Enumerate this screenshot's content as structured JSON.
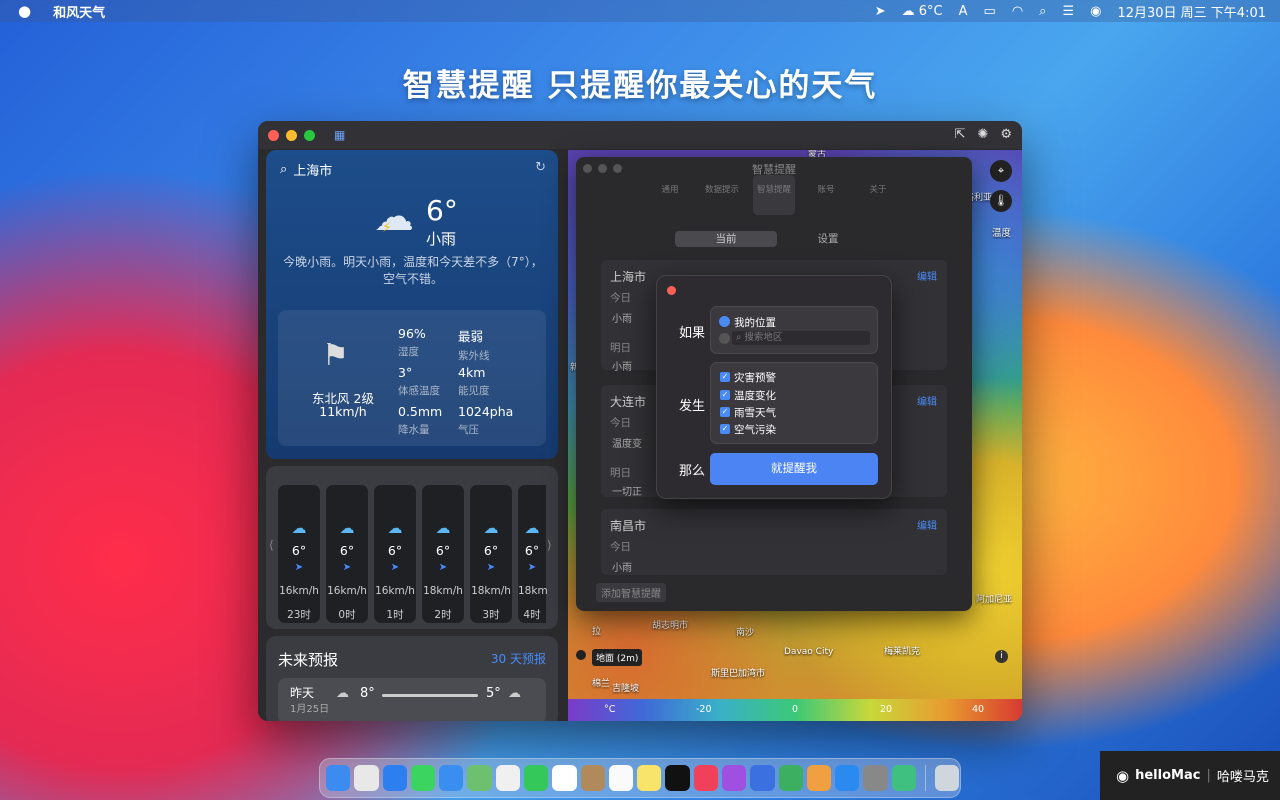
{
  "menubar": {
    "app_name": "和风天气",
    "temp": "6°C",
    "ime": "A",
    "datetime": "12月30日 周三 下午4:01"
  },
  "headline": "智慧提醒  只提醒你最关心的天气",
  "weather": {
    "city": "上海市",
    "temp": "6°",
    "condition": "小雨",
    "summary": "今晚小雨。明天小雨，温度和今天差不多（7°），空气不错。",
    "wind_dir": "东北风 2级",
    "wind_speed": "11km/h",
    "stats": [
      {
        "value": "96%",
        "label": "湿度"
      },
      {
        "value": "最弱",
        "label": "紫外线"
      },
      {
        "value": "3°",
        "label": "体感温度"
      },
      {
        "value": "4km",
        "label": "能见度"
      },
      {
        "value": "0.5mm",
        "label": "降水量"
      },
      {
        "value": "1024pha",
        "label": "气压"
      }
    ],
    "hourly": [
      {
        "temp": "6°",
        "speed": "16km/h",
        "hour": "23时"
      },
      {
        "temp": "6°",
        "speed": "16km/h",
        "hour": "0时"
      },
      {
        "temp": "6°",
        "speed": "16km/h",
        "hour": "1时"
      },
      {
        "temp": "6°",
        "speed": "18km/h",
        "hour": "2时"
      },
      {
        "temp": "6°",
        "speed": "18km/h",
        "hour": "3时"
      },
      {
        "temp": "6°",
        "speed": "18km",
        "hour": "4时"
      }
    ],
    "forecast_title": "未来预报",
    "forecast_more": "30 天预报",
    "forecast_row": {
      "day": "昨天",
      "date": "1月25日",
      "high": "8°",
      "low": "5°"
    }
  },
  "map": {
    "temp_label": "温度",
    "surface": "地面 (2m)",
    "unit": "°C",
    "scale": [
      "-20",
      "0",
      "20",
      "40"
    ],
    "labels": [
      "蒙古",
      "格利亚",
      "阿加尼亚",
      "拉",
      "胡志明市",
      "南沙",
      "Davao City",
      "梅莱凯克",
      "斯里巴加湾市",
      "吉隆坡",
      "棉兰",
      "新"
    ]
  },
  "prefs": {
    "title": "智慧提醒",
    "toolbar": [
      "通用",
      "数据提示",
      "智慧提醒",
      "账号",
      "关于"
    ],
    "seg": [
      "当前",
      "设置"
    ],
    "groups": [
      {
        "city": "上海市",
        "edit": "编辑",
        "today": "今日",
        "today_item": "小雨",
        "tomorrow": "明日",
        "tomorrow_item": "小雨"
      },
      {
        "city": "大连市",
        "edit": "编辑",
        "today": "今日",
        "today_item": "温度变",
        "tomorrow": "明日",
        "tomorrow_item": "一切正"
      },
      {
        "city": "南昌市",
        "edit": "编辑",
        "today": "今日",
        "today_item": "小雨"
      }
    ],
    "add": "添加智慧提醒"
  },
  "modal": {
    "if_label": "如果",
    "my_location": "我的位置",
    "search_placeholder": "搜索地区",
    "when_label": "发生",
    "conditions": [
      "灾害预警",
      "温度变化",
      "雨雪天气",
      "空气污染"
    ],
    "then_label": "那么",
    "button": "就提醒我"
  },
  "watermark": {
    "brand": "helloMac",
    "cn": "哈喽马克"
  }
}
